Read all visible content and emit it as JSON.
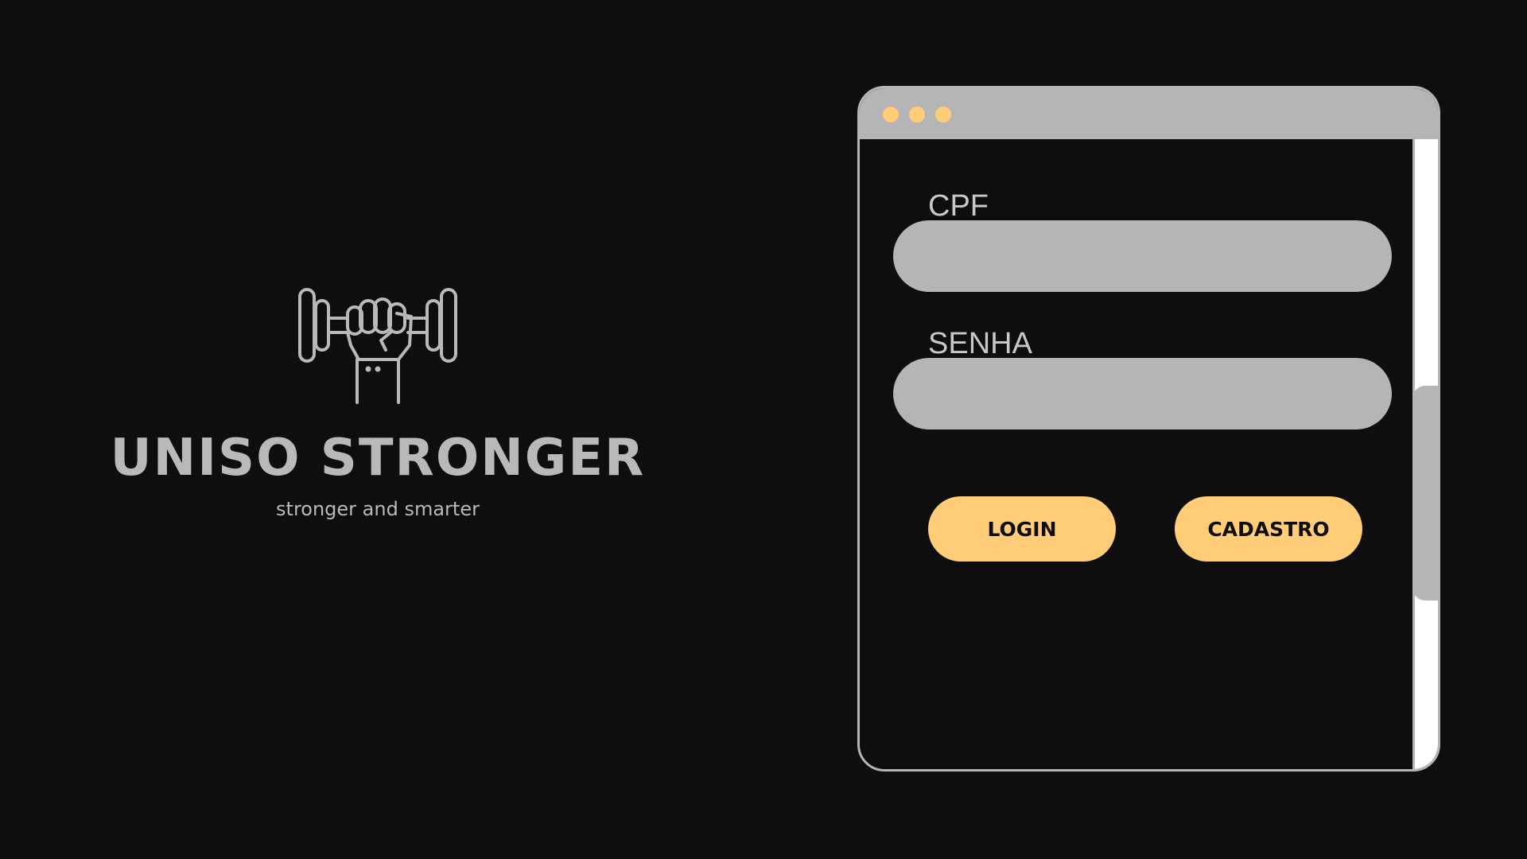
{
  "brand": {
    "title": "UNISO STRONGER",
    "subtitle": "stronger and smarter",
    "logo_icon": "fist-dumbbell-icon"
  },
  "window": {
    "dot_color": "#ffcd77",
    "titlebar_color": "#b5b5b5"
  },
  "form": {
    "cpf_label": "CPF",
    "cpf_value": "",
    "senha_label": "SENHA",
    "senha_value": "",
    "login_label": "LOGIN",
    "cadastro_label": "CADASTRO"
  },
  "colors": {
    "background": "#0e0e0e",
    "accent": "#ffcd77",
    "field": "#b5b5b5"
  }
}
